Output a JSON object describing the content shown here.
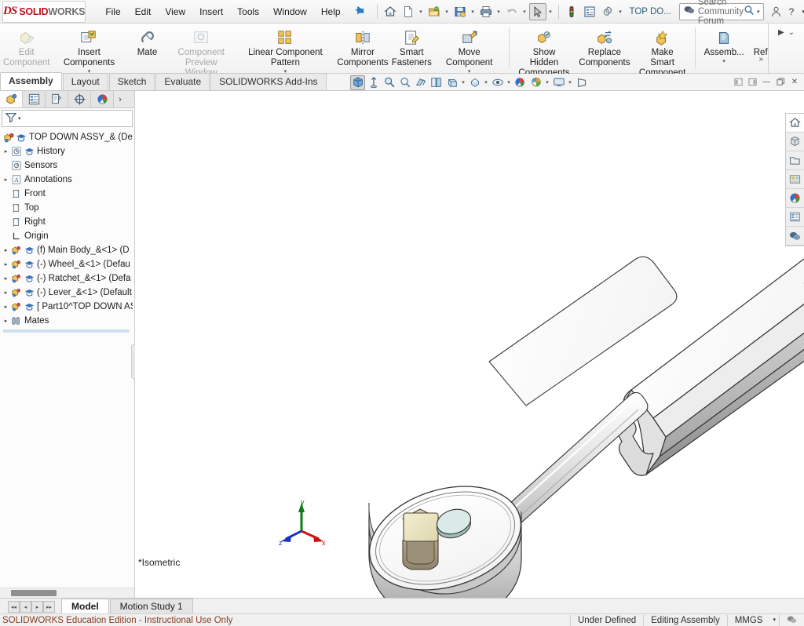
{
  "app": {
    "logo_ds": "DS",
    "logo_solid": "SOLID",
    "logo_works": "WORKS",
    "document_name": "TOP DO..."
  },
  "menubar": {
    "items": [
      {
        "label": "File"
      },
      {
        "label": "Edit"
      },
      {
        "label": "View"
      },
      {
        "label": "Insert"
      },
      {
        "label": "Tools"
      },
      {
        "label": "Window"
      },
      {
        "label": "Help"
      }
    ],
    "pin_icon": "pushpin-icon",
    "quick_access": [
      {
        "name": "new-document-home-icon",
        "glyph": "⌂"
      },
      {
        "name": "new-document-icon",
        "glyph": "὜B"
      },
      {
        "name": "open-document-icon",
        "glyph": "folder"
      },
      {
        "name": "save-icon",
        "glyph": "save"
      },
      {
        "name": "print-icon",
        "glyph": "printer"
      },
      {
        "name": "undo-icon",
        "glyph": "↶"
      },
      {
        "name": "select-icon",
        "glyph": "arrow"
      },
      {
        "name": "rebuild-icon",
        "glyph": "traffic-light"
      },
      {
        "name": "options-list-icon",
        "glyph": "list"
      },
      {
        "name": "options-gear-icon",
        "glyph": "gear"
      }
    ]
  },
  "search": {
    "placeholder": "Search Community Forum",
    "value": "Search Community Forum",
    "icon": "forum-icon",
    "magnifier": "search-icon",
    "dropdown": "chevron-down-icon"
  },
  "window_controls": {
    "profile": "user-icon",
    "help": "?",
    "help_caret": "▾",
    "minimize": "—",
    "restore": "❐",
    "close": "✕"
  },
  "ribbon": {
    "groups": [
      {
        "buttons": [
          {
            "label": "Edit\nComponent",
            "icon": "edit-component-icon",
            "disabled": true,
            "caret": false
          },
          {
            "label": "Insert Components",
            "icon": "insert-components-icon",
            "disabled": false,
            "caret": true
          },
          {
            "label": "Mate",
            "icon": "mate-icon",
            "disabled": false,
            "caret": false
          },
          {
            "label": "Component\nPreview Window",
            "icon": "component-preview-window-icon",
            "disabled": true,
            "caret": false
          },
          {
            "label": "Linear Component Pattern",
            "icon": "linear-component-pattern-icon",
            "disabled": false,
            "caret": true
          },
          {
            "label": "Mirror\nComponents",
            "icon": "mirror-components-icon",
            "disabled": false,
            "caret": false
          },
          {
            "label": "Smart\nFasteners",
            "icon": "smart-fasteners-icon",
            "disabled": false,
            "caret": false
          },
          {
            "label": "Move Component",
            "icon": "move-component-icon",
            "disabled": false,
            "caret": true
          }
        ]
      },
      {
        "buttons": [
          {
            "label": "Show Hidden\nComponents",
            "icon": "show-hidden-components-icon",
            "disabled": false,
            "caret": false
          },
          {
            "label": "Replace\nComponents",
            "icon": "replace-components-icon",
            "disabled": false,
            "caret": false
          },
          {
            "label": "Make Smart\nComponent",
            "icon": "make-smart-component-icon",
            "disabled": false,
            "caret": false
          }
        ]
      },
      {
        "buttons": [
          {
            "label": "Assemb...",
            "icon": "assembly-features-icon",
            "disabled": false,
            "caret": true
          },
          {
            "label": "Referenc...",
            "icon": "reference-geometry-icon",
            "disabled": false,
            "caret": true
          }
        ]
      }
    ],
    "overflow": "»",
    "right_controls": [
      {
        "name": "ribbon-play-icon",
        "glyph": "▶"
      },
      {
        "name": "ribbon-collapse-icon",
        "glyph": "⌄"
      }
    ]
  },
  "command_tabs": [
    {
      "label": "Assembly",
      "active": true
    },
    {
      "label": "Layout",
      "active": false
    },
    {
      "label": "Sketch",
      "active": false
    },
    {
      "label": "Evaluate",
      "active": false
    },
    {
      "label": "SOLIDWORKS Add-Ins",
      "active": false
    }
  ],
  "view_toolbar": [
    {
      "name": "zoom-to-fit-icon",
      "active": true,
      "caret": false
    },
    {
      "name": "zoom-to-area-icon",
      "active": false,
      "caret": false
    },
    {
      "name": "zoom-in-out-icon",
      "active": false,
      "caret": false
    },
    {
      "name": "previous-view-icon",
      "active": false,
      "caret": false
    },
    {
      "name": "section-view-icon",
      "active": false,
      "caret": false
    },
    {
      "name": "view-orientation-icon",
      "active": false,
      "caret": false
    },
    {
      "name": "display-style-icon",
      "active": false,
      "caret": true
    },
    {
      "name": "hide-show-items-icon",
      "active": false,
      "caret": true
    },
    {
      "name": "edit-appearance-icon",
      "active": false,
      "caret": false
    },
    {
      "name": "apply-scene-icon",
      "active": false,
      "caret": true
    },
    {
      "name": "view-setting-icon",
      "active": false,
      "caret": true
    },
    {
      "name": "perspective-icon",
      "active": false,
      "caret": false
    }
  ],
  "doc_window_controls": [
    {
      "name": "restore-down-left-icon",
      "glyph": "▣"
    },
    {
      "name": "restore-down-right-icon",
      "glyph": "▣"
    },
    {
      "name": "doc-minimize-icon",
      "glyph": "—"
    },
    {
      "name": "doc-restore-icon",
      "glyph": "❐"
    },
    {
      "name": "doc-close-icon",
      "glyph": "✕"
    }
  ],
  "feature_manager": {
    "tabs": [
      {
        "name": "feature-manager-design-tree-tab",
        "active": true
      },
      {
        "name": "property-manager-tab",
        "active": false
      },
      {
        "name": "configuration-manager-tab",
        "active": false
      },
      {
        "name": "dimxpert-manager-tab",
        "active": false
      },
      {
        "name": "display-manager-tab",
        "active": false
      }
    ],
    "tabs_more": "›",
    "filter": {
      "icon": "filter-icon",
      "caret": "▾",
      "value": ""
    },
    "tree": [
      {
        "label": "TOP DOWN ASSY_&  (Defa",
        "icon": "assembly-icon",
        "indent": 0,
        "expand": "",
        "overlay": true
      },
      {
        "label": "History",
        "icon": "history-icon",
        "indent": 1,
        "expand": "▸",
        "overlay": true
      },
      {
        "label": "Sensors",
        "icon": "sensors-icon",
        "indent": 1,
        "expand": "",
        "overlay": false
      },
      {
        "label": "Annotations",
        "icon": "annotations-icon",
        "indent": 1,
        "expand": "▸",
        "overlay": false
      },
      {
        "label": "Front",
        "icon": "plane-icon",
        "indent": 1,
        "expand": "",
        "overlay": false
      },
      {
        "label": "Top",
        "icon": "plane-icon",
        "indent": 1,
        "expand": "",
        "overlay": false
      },
      {
        "label": "Right",
        "icon": "plane-icon",
        "indent": 1,
        "expand": "",
        "overlay": false
      },
      {
        "label": "Origin",
        "icon": "origin-icon",
        "indent": 1,
        "expand": "",
        "overlay": false
      },
      {
        "label": "(f) Main Body_&<1>  (D",
        "icon": "component-icon",
        "indent": 1,
        "expand": "▸",
        "overlay": true
      },
      {
        "label": "(-) Wheel_&<1>  (Defau",
        "icon": "component-icon",
        "indent": 1,
        "expand": "▸",
        "overlay": true
      },
      {
        "label": "(-) Ratchet_&<1>  (Defa",
        "icon": "component-icon",
        "indent": 1,
        "expand": "▸",
        "overlay": true
      },
      {
        "label": "(-) Lever_&<1>  (Default",
        "icon": "component-icon",
        "indent": 1,
        "expand": "▸",
        "overlay": true
      },
      {
        "label": "[ Part10^TOP DOWN AS",
        "icon": "component-icon",
        "indent": 1,
        "expand": "▸",
        "overlay": true
      },
      {
        "label": "Mates",
        "icon": "mates-icon",
        "indent": 1,
        "expand": "▸",
        "overlay": false
      }
    ]
  },
  "task_pane": [
    {
      "name": "solidworks-resources-home-icon",
      "active": true
    },
    {
      "name": "design-library-icon",
      "active": false
    },
    {
      "name": "file-explorer-icon",
      "active": false
    },
    {
      "name": "view-palette-icon",
      "active": false
    },
    {
      "name": "appearances-scenes-decals-icon",
      "active": false
    },
    {
      "name": "custom-properties-icon",
      "active": false
    },
    {
      "name": "solidworks-forum-icon",
      "active": false
    }
  ],
  "graphics": {
    "view_label": "*Isometric",
    "triad": {
      "x_label": "x",
      "y_label": "y",
      "z_label": "z",
      "x_color": "#cc1111",
      "y_color": "#0a7a18",
      "z_color": "#1a2fc4"
    },
    "model": {
      "name": "ratchet-wrench-assembly",
      "body_color": "#d9d9d9",
      "highlight_color": "#ffffff",
      "drive_color": "#e8e2c0",
      "button_color": "#d8eae8",
      "edge_color": "#3a3a3a"
    },
    "cursor": "mouse-pointer-icon"
  },
  "bottom": {
    "nav_arrows": [
      "◂◂",
      "◂",
      "▸",
      "▸▸"
    ],
    "sheet_tabs": [
      {
        "label": "Model",
        "active": true
      },
      {
        "label": "Motion Study 1",
        "active": false
      }
    ]
  },
  "statusbar": {
    "education_note": "SOLIDWORKS Education Edition - Instructional Use Only",
    "state": "Under Defined",
    "mode": "Editing Assembly",
    "units": "MMGS",
    "units_caret": "▾",
    "overlay_icon": "overlay-icon"
  }
}
